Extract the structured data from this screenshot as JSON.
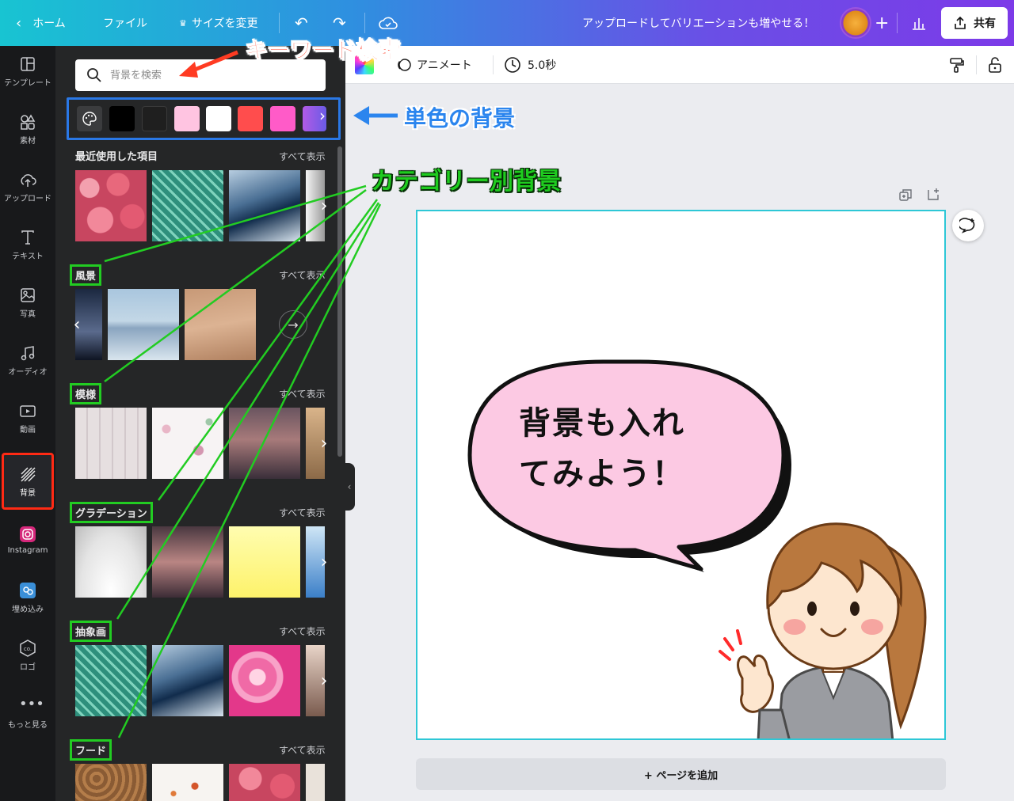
{
  "topbar": {
    "home": "ホーム",
    "file": "ファイル",
    "resize": "サイズを変更",
    "upgrade_text": "アップロードしてバリエーションも増やせる！",
    "share": "共有"
  },
  "leftnav": {
    "items": [
      {
        "label": "テンプレート",
        "icon": "template-icon"
      },
      {
        "label": "素材",
        "icon": "elements-icon"
      },
      {
        "label": "アップロード",
        "icon": "upload-icon"
      },
      {
        "label": "テキスト",
        "icon": "text-icon"
      },
      {
        "label": "写真",
        "icon": "photo-icon"
      },
      {
        "label": "オーディオ",
        "icon": "audio-icon"
      },
      {
        "label": "動画",
        "icon": "video-icon"
      },
      {
        "label": "背景",
        "icon": "background-icon"
      },
      {
        "label": "Instagram",
        "icon": "instagram-icon"
      },
      {
        "label": "埋め込み",
        "icon": "embed-icon"
      },
      {
        "label": "ロゴ",
        "icon": "logo-icon"
      },
      {
        "label": "もっと見る",
        "icon": "more-icon"
      }
    ]
  },
  "panel": {
    "search_placeholder": "背景を検索",
    "swatches": [
      "#000000",
      "#1f1f1f",
      "#ffc4e1",
      "#ffffff",
      "#ff4d4d",
      "#ff5bc8",
      "#b25be6"
    ],
    "show_all": "すべて表示",
    "sections": [
      {
        "title": "最近使用した項目"
      },
      {
        "title": "風景"
      },
      {
        "title": "模様"
      },
      {
        "title": "グラデーション"
      },
      {
        "title": "抽象画"
      },
      {
        "title": "フード"
      }
    ]
  },
  "editor": {
    "animate": "アニメート",
    "duration": "5.0秒",
    "add_page": "+ ページを追加",
    "bubble_line1": "背景も入れ",
    "bubble_line2": "てみよう！"
  },
  "annotations": {
    "keyword_search": "キーワード検索",
    "solid_background": "単色の背景",
    "category_background": "カテゴリー別背景"
  }
}
